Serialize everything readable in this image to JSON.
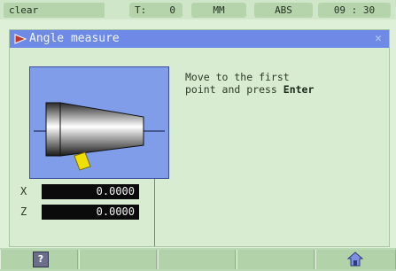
{
  "status_bar": {
    "mode": "clear",
    "tool_label": "T:",
    "tool_value": "0",
    "units": "MM",
    "coords": "ABS",
    "time": "09 : 30"
  },
  "window": {
    "title": "Angle measure",
    "message_line1": "Move to the first",
    "message_line2_prefix": "point and press ",
    "message_key": "Enter"
  },
  "axes": [
    {
      "label": "X",
      "value": "0.0000"
    },
    {
      "label": "Z",
      "value": "0.0000"
    }
  ],
  "softkeys": [
    {
      "icon": "help-icon",
      "label": "?"
    },
    {
      "icon": "",
      "label": ""
    },
    {
      "icon": "",
      "label": ""
    },
    {
      "icon": "",
      "label": ""
    },
    {
      "icon": "home-icon",
      "label": ""
    }
  ],
  "colors": {
    "background": "#dff0d8",
    "titlebar": "#6e8ae6",
    "illustration_bg": "#7f9de9",
    "readout_bg": "#0b0b0b",
    "probe": "#f0e000"
  }
}
